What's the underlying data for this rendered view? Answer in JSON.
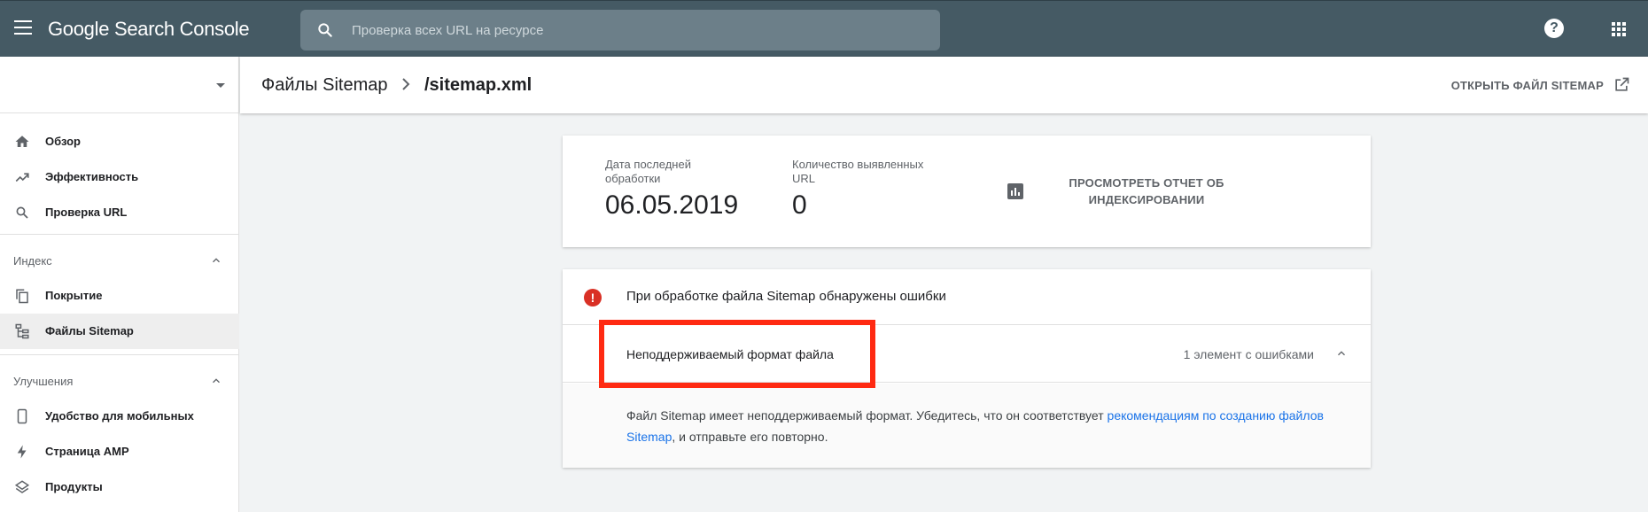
{
  "topbar": {
    "logo_text": "Google Search Console",
    "search_placeholder": "Проверка всех URL на ресурсе"
  },
  "sidebar": {
    "items_primary": [
      {
        "label": "Обзор",
        "icon": "home-icon"
      },
      {
        "label": "Эффективность",
        "icon": "trending-up-icon"
      },
      {
        "label": "Проверка URL",
        "icon": "search-icon"
      }
    ],
    "section_index": {
      "label": "Индекс",
      "items": [
        {
          "label": "Покрытие",
          "icon": "copy-icon"
        },
        {
          "label": "Файлы Sitemap",
          "icon": "sitemap-icon",
          "active": true
        }
      ]
    },
    "section_improvements": {
      "label": "Улучшения",
      "items": [
        {
          "label": "Удобство для мобильных",
          "icon": "smartphone-icon"
        },
        {
          "label": "Страница AMP",
          "icon": "bolt-icon"
        },
        {
          "label": "Продукты",
          "icon": "layers-icon"
        }
      ]
    }
  },
  "header": {
    "breadcrumb_parent": "Файлы Sitemap",
    "breadcrumb_current": "/sitemap.xml",
    "open_link": "ОТКРЫТЬ ФАЙЛ SITEMAP"
  },
  "stats": {
    "last_processed_label": "Дата последней обработки",
    "last_processed_value": "06.05.2019",
    "urls_found_label": "Количество выявленных URL",
    "urls_found_value": "0",
    "report_link": "ПРОСМОТРЕТЬ ОТЧЕТ ОБ ИНДЕКСИРОВАНИИ"
  },
  "errors": {
    "title": "При обработке файла Sitemap обнаружены ошибки",
    "issue_title": "Неподдерживаемый формат файла",
    "issue_count": "1 элемент с ошибками",
    "desc_before": "Файл Sitemap имеет неподдерживаемый формат. Убедитесь, что он соответствует ",
    "desc_link": "рекомендациям по созданию файлов Sitemap",
    "desc_after": ", и отправьте его повторно."
  },
  "colors": {
    "topbar": "#455a64",
    "error_red": "#d93025",
    "link_blue": "#1a73e8",
    "highlight_red": "#ff2a12"
  }
}
